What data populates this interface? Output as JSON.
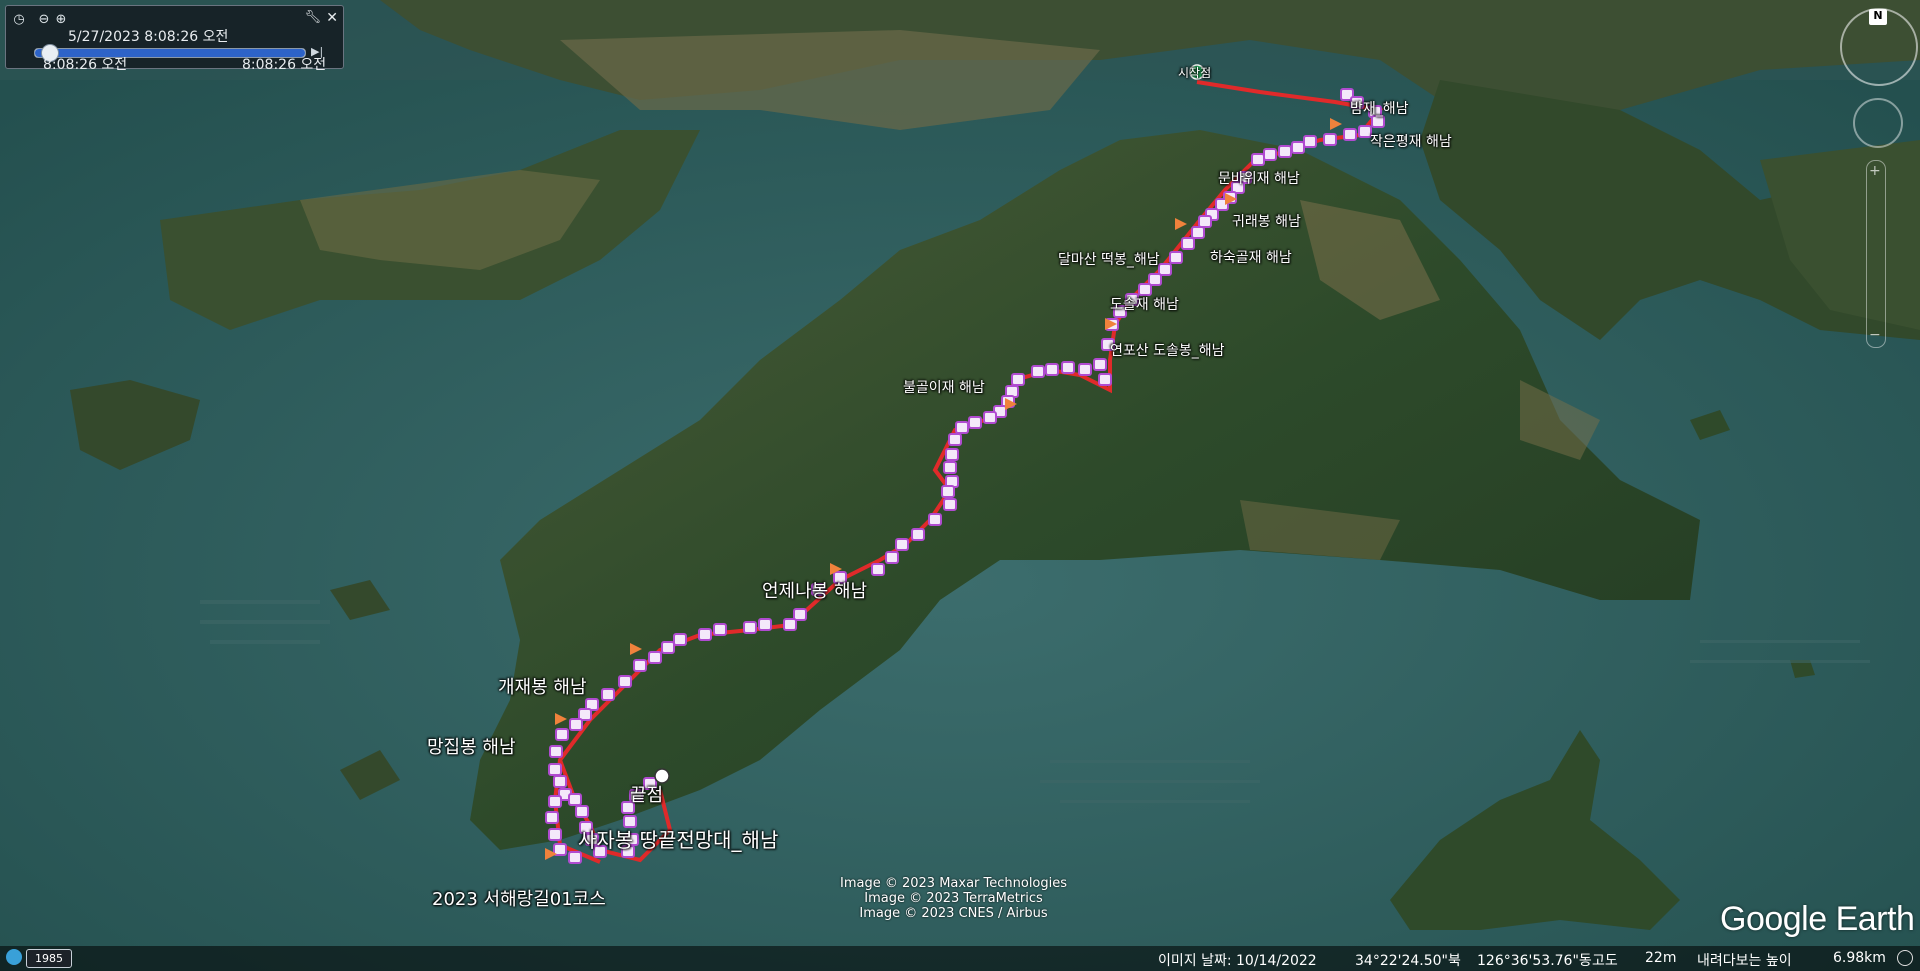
{
  "time_slider": {
    "current": "5/27/2023    8:08:26 오전",
    "start": "8:08:26 오전",
    "end": "8:08:26 오전",
    "progress": 0.05
  },
  "compass": {
    "north": "N"
  },
  "labels": {
    "start_point": "시작점",
    "p1": "밤재_해남",
    "p2": "작은평재 해남",
    "p3": "문바위재 해남",
    "p4": "귀래봉 해남",
    "p5": "달마산 떡봉_해남",
    "p6": "하숙골재 해남",
    "p7": "도솔재 해남",
    "p8": "연포산 도솔봉_해남",
    "p9": "불골이재 해남",
    "p10": "언제나봉 해남",
    "p11": "개재봉 해남",
    "p12": "망집봉 해남",
    "end_point": "끝점",
    "p13": "사자봉 땅끝전망대_해남",
    "course": "2023 서해랑길01코스"
  },
  "credits": [
    "Image © 2023 Maxar Technologies",
    "Image © 2023 TerraMetrics",
    "Image © 2023 CNES / Airbus"
  ],
  "logo": "Google Earth",
  "status": {
    "year": "1985",
    "image_date": "이미지 날짜: 10/14/2022",
    "lat": "34°22'24.50\"북",
    "lon": "126°36'53.76\"동",
    "elev_label": "고도",
    "elev": "22m",
    "eye_label": "내려다보는 높이",
    "eye": "6.98km"
  },
  "colors": {
    "track": "#e02a2a",
    "marker": "#b04bd0",
    "flag": "#f0823c",
    "sea": "#2d5f62",
    "land": "#2f4a2a"
  }
}
